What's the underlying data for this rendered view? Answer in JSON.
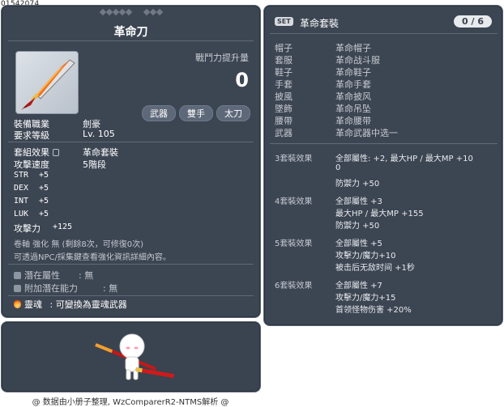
{
  "item_id": "01542074",
  "tooltip": {
    "title": "革命刀",
    "cp_label": "戰鬥力提升量",
    "cp_value": "0",
    "tags": [
      "武器",
      "雙手",
      "太刀"
    ],
    "job_label": "裝備職業",
    "job_value": "劍豪",
    "level_label": "要求等級",
    "level_value": "Lv. 105",
    "set_label": "套組效果",
    "set_value": "革命套裝",
    "speed_label": "攻擊速度",
    "speed_value": "5階段",
    "stats": [
      {
        "name": "STR",
        "value": "+5"
      },
      {
        "name": "DEX",
        "value": "+5"
      },
      {
        "name": "INT",
        "value": "+5"
      },
      {
        "name": "LUK",
        "value": "+5"
      }
    ],
    "attack_label": "攻擊力",
    "attack_value": "+125",
    "scroll_line": "卷軸 強化 無 (剩餘8次，可修復0次)",
    "npc_line": "可透過NPC/採集鍵查看強化資訊詳細內容。",
    "potential_label": "潛在屬性",
    "potential_value": ": 無",
    "bonus_label": "附加潛在能力",
    "bonus_value": ": 無",
    "soul_label": "靈魂",
    "soul_value": ": 可變換為靈魂武器"
  },
  "set": {
    "badge": "SET",
    "name": "革命套裝",
    "count": "0 / 6",
    "parts": [
      {
        "slot": "帽子",
        "name": "革命帽子"
      },
      {
        "slot": "套服",
        "name": "革命战斗服"
      },
      {
        "slot": "鞋子",
        "name": "革命鞋子"
      },
      {
        "slot": "手套",
        "name": "革命手套"
      },
      {
        "slot": "披風",
        "name": "革命披风"
      },
      {
        "slot": "墜飾",
        "name": "革命吊坠"
      },
      {
        "slot": "腰帶",
        "name": "革命腰带"
      },
      {
        "slot": "武器",
        "name": "革命武器中选一"
      }
    ],
    "bonuses": [
      {
        "head": "3套裝效果",
        "lines": [
          "全部屬性: +2, 最大HP / 最大MP +10",
          "0",
          "防禦力 +50"
        ]
      },
      {
        "head": "4套裝效果",
        "lines": [
          "全部屬性 +3",
          "最大HP / 最大MP +155",
          "防禦力 +50"
        ]
      },
      {
        "head": "5套裝效果",
        "lines": [
          "全部屬性 +5",
          "攻擊力/魔力+10",
          "被击后无敌时间 +1秒"
        ]
      },
      {
        "head": "6套裝效果",
        "lines": [
          "全部屬性 +7",
          "攻擊力/魔力+15",
          "首领怪物伤害 +20%"
        ]
      }
    ]
  },
  "footer": "@ 数据由小册子整理, WzComparerR2-NTMS解析 @",
  "icons": {
    "item": "katana-icon",
    "lock": "lock-icon",
    "potential": "box-icon",
    "soul": "flame-icon",
    "character": "character-icon"
  },
  "colors": {
    "panel": "#3c4552",
    "text": "#ffffff",
    "muted": "#c6cbd2"
  }
}
